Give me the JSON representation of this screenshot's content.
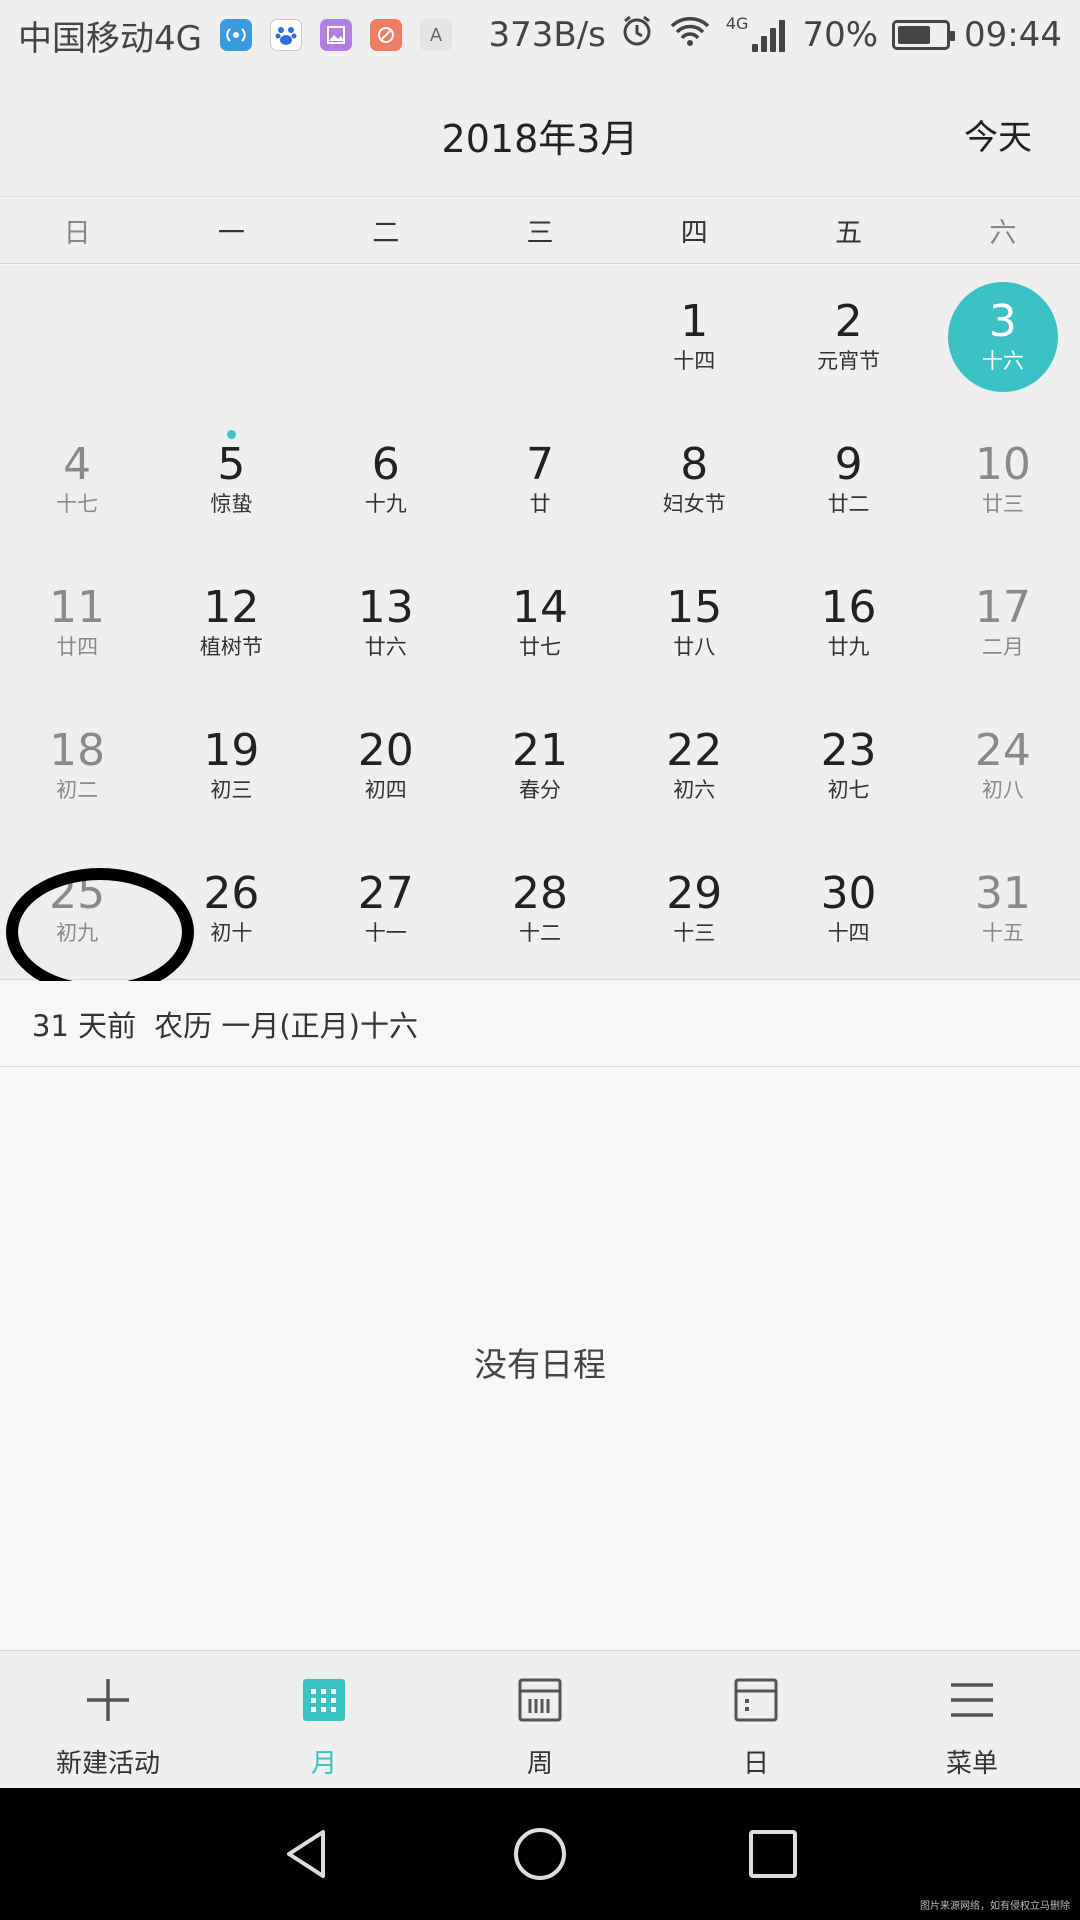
{
  "status_bar": {
    "carrier": "中国移动4G",
    "net_speed": "373B/s",
    "network_tag": "4G",
    "battery_percent": "70%",
    "battery_level": 0.7,
    "time": "09:44",
    "notification_icons": [
      "hotspot-icon",
      "baidu-icon",
      "gallery-icon",
      "app-icon",
      "keyboard-icon"
    ],
    "keyboard_icon_letter": "A"
  },
  "header": {
    "title": "2018年3月",
    "today_label": "今天"
  },
  "weekdays": [
    "日",
    "一",
    "二",
    "三",
    "四",
    "五",
    "六"
  ],
  "weeks": [
    [
      {
        "num": "",
        "sub": ""
      },
      {
        "num": "",
        "sub": ""
      },
      {
        "num": "",
        "sub": ""
      },
      {
        "num": "",
        "sub": ""
      },
      {
        "num": "1",
        "sub": "十四"
      },
      {
        "num": "2",
        "sub": "元宵节"
      },
      {
        "num": "3",
        "sub": "十六",
        "selected": true
      }
    ],
    [
      {
        "num": "4",
        "sub": "十七"
      },
      {
        "num": "5",
        "sub": "惊蛰",
        "event": true
      },
      {
        "num": "6",
        "sub": "十九"
      },
      {
        "num": "7",
        "sub": "廿"
      },
      {
        "num": "8",
        "sub": "妇女节"
      },
      {
        "num": "9",
        "sub": "廿二"
      },
      {
        "num": "10",
        "sub": "廿三"
      }
    ],
    [
      {
        "num": "11",
        "sub": "廿四"
      },
      {
        "num": "12",
        "sub": "植树节"
      },
      {
        "num": "13",
        "sub": "廿六"
      },
      {
        "num": "14",
        "sub": "廿七"
      },
      {
        "num": "15",
        "sub": "廿八"
      },
      {
        "num": "16",
        "sub": "廿九"
      },
      {
        "num": "17",
        "sub": "二月"
      }
    ],
    [
      {
        "num": "18",
        "sub": "初二"
      },
      {
        "num": "19",
        "sub": "初三"
      },
      {
        "num": "20",
        "sub": "初四"
      },
      {
        "num": "21",
        "sub": "春分"
      },
      {
        "num": "22",
        "sub": "初六"
      },
      {
        "num": "23",
        "sub": "初七"
      },
      {
        "num": "24",
        "sub": "初八"
      }
    ],
    [
      {
        "num": "25",
        "sub": "初九"
      },
      {
        "num": "26",
        "sub": "初十"
      },
      {
        "num": "27",
        "sub": "十一"
      },
      {
        "num": "28",
        "sub": "十二"
      },
      {
        "num": "29",
        "sub": "十三"
      },
      {
        "num": "30",
        "sub": "十四"
      },
      {
        "num": "31",
        "sub": "十五"
      }
    ]
  ],
  "info": {
    "relative": "31 天前",
    "lunar": "农历 一月(正月)十六"
  },
  "empty_text": "没有日程",
  "toolbar": {
    "new_event": "新建活动",
    "month": "月",
    "week": "周",
    "day": "日",
    "menu": "菜单"
  },
  "watermark": "图片来源网络，如有侵权立马删除",
  "colors": {
    "accent": "#3bc1c3",
    "background": "#f7f7f7",
    "header_bg": "#efefef"
  }
}
